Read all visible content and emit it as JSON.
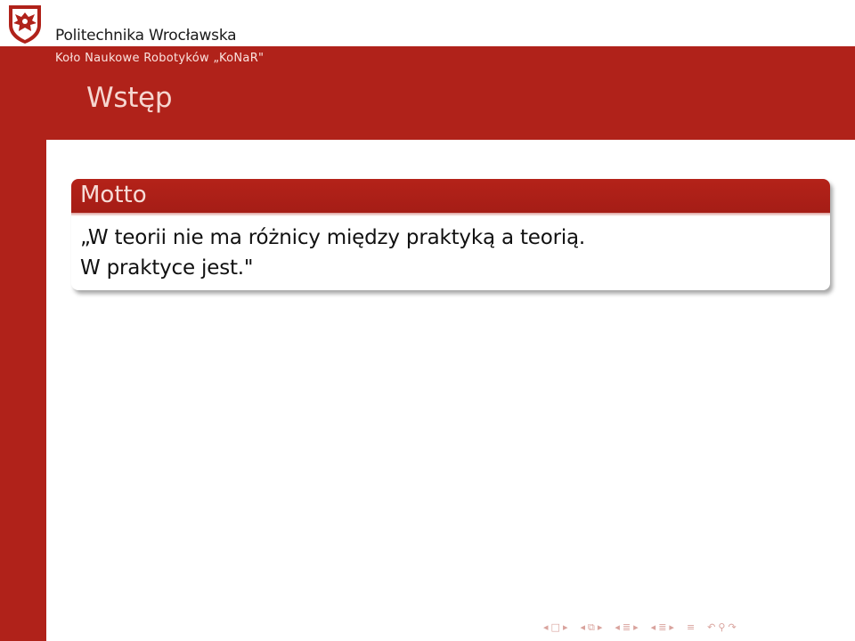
{
  "header": {
    "university": "Politechnika Wrocławska",
    "subtitle": "Koło Naukowe Robotyków „KoNaR\"",
    "frame_title": "Wstęp"
  },
  "block": {
    "title": "Motto",
    "line1": "„W teorii nie ma różnicy między praktyką a teorią.",
    "line2": "W praktyce jest.\""
  },
  "nav": {
    "slide_prev": "◂",
    "slide_icon": "□",
    "slide_next": "▸",
    "frame_prev": "◂",
    "frame_icon": "⧉",
    "frame_next": "▸",
    "subsection_prev": "◂",
    "subsection_icon": "≣",
    "subsection_next": "▸",
    "section_prev": "◂",
    "section_icon": "≣",
    "section_next": "▸",
    "doc_icon": "≡",
    "back": "↶",
    "search": "⚲",
    "forward": "↷"
  },
  "colors": {
    "brand_red": "#b0221a",
    "title_text": "#f6d6d0",
    "nav_symbols": "#d9a39d"
  }
}
